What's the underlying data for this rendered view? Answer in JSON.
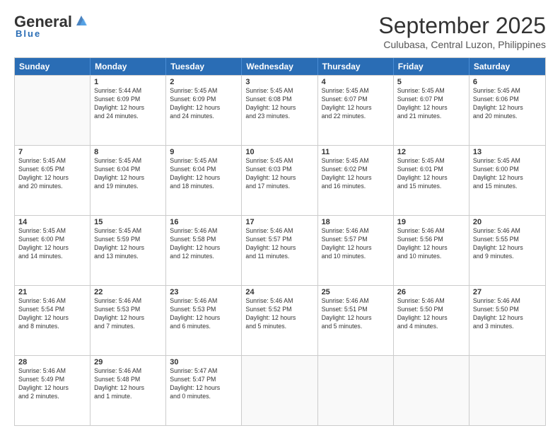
{
  "header": {
    "logo_general": "General",
    "logo_blue": "Blue",
    "month_title": "September 2025",
    "subtitle": "Culubasa, Central Luzon, Philippines"
  },
  "weekdays": [
    "Sunday",
    "Monday",
    "Tuesday",
    "Wednesday",
    "Thursday",
    "Friday",
    "Saturday"
  ],
  "weeks": [
    [
      {
        "day": "",
        "info": ""
      },
      {
        "day": "1",
        "info": "Sunrise: 5:44 AM\nSunset: 6:09 PM\nDaylight: 12 hours\nand 24 minutes."
      },
      {
        "day": "2",
        "info": "Sunrise: 5:45 AM\nSunset: 6:09 PM\nDaylight: 12 hours\nand 24 minutes."
      },
      {
        "day": "3",
        "info": "Sunrise: 5:45 AM\nSunset: 6:08 PM\nDaylight: 12 hours\nand 23 minutes."
      },
      {
        "day": "4",
        "info": "Sunrise: 5:45 AM\nSunset: 6:07 PM\nDaylight: 12 hours\nand 22 minutes."
      },
      {
        "day": "5",
        "info": "Sunrise: 5:45 AM\nSunset: 6:07 PM\nDaylight: 12 hours\nand 21 minutes."
      },
      {
        "day": "6",
        "info": "Sunrise: 5:45 AM\nSunset: 6:06 PM\nDaylight: 12 hours\nand 20 minutes."
      }
    ],
    [
      {
        "day": "7",
        "info": "Sunrise: 5:45 AM\nSunset: 6:05 PM\nDaylight: 12 hours\nand 20 minutes."
      },
      {
        "day": "8",
        "info": "Sunrise: 5:45 AM\nSunset: 6:04 PM\nDaylight: 12 hours\nand 19 minutes."
      },
      {
        "day": "9",
        "info": "Sunrise: 5:45 AM\nSunset: 6:04 PM\nDaylight: 12 hours\nand 18 minutes."
      },
      {
        "day": "10",
        "info": "Sunrise: 5:45 AM\nSunset: 6:03 PM\nDaylight: 12 hours\nand 17 minutes."
      },
      {
        "day": "11",
        "info": "Sunrise: 5:45 AM\nSunset: 6:02 PM\nDaylight: 12 hours\nand 16 minutes."
      },
      {
        "day": "12",
        "info": "Sunrise: 5:45 AM\nSunset: 6:01 PM\nDaylight: 12 hours\nand 15 minutes."
      },
      {
        "day": "13",
        "info": "Sunrise: 5:45 AM\nSunset: 6:00 PM\nDaylight: 12 hours\nand 15 minutes."
      }
    ],
    [
      {
        "day": "14",
        "info": "Sunrise: 5:45 AM\nSunset: 6:00 PM\nDaylight: 12 hours\nand 14 minutes."
      },
      {
        "day": "15",
        "info": "Sunrise: 5:45 AM\nSunset: 5:59 PM\nDaylight: 12 hours\nand 13 minutes."
      },
      {
        "day": "16",
        "info": "Sunrise: 5:46 AM\nSunset: 5:58 PM\nDaylight: 12 hours\nand 12 minutes."
      },
      {
        "day": "17",
        "info": "Sunrise: 5:46 AM\nSunset: 5:57 PM\nDaylight: 12 hours\nand 11 minutes."
      },
      {
        "day": "18",
        "info": "Sunrise: 5:46 AM\nSunset: 5:57 PM\nDaylight: 12 hours\nand 10 minutes."
      },
      {
        "day": "19",
        "info": "Sunrise: 5:46 AM\nSunset: 5:56 PM\nDaylight: 12 hours\nand 10 minutes."
      },
      {
        "day": "20",
        "info": "Sunrise: 5:46 AM\nSunset: 5:55 PM\nDaylight: 12 hours\nand 9 minutes."
      }
    ],
    [
      {
        "day": "21",
        "info": "Sunrise: 5:46 AM\nSunset: 5:54 PM\nDaylight: 12 hours\nand 8 minutes."
      },
      {
        "day": "22",
        "info": "Sunrise: 5:46 AM\nSunset: 5:53 PM\nDaylight: 12 hours\nand 7 minutes."
      },
      {
        "day": "23",
        "info": "Sunrise: 5:46 AM\nSunset: 5:53 PM\nDaylight: 12 hours\nand 6 minutes."
      },
      {
        "day": "24",
        "info": "Sunrise: 5:46 AM\nSunset: 5:52 PM\nDaylight: 12 hours\nand 5 minutes."
      },
      {
        "day": "25",
        "info": "Sunrise: 5:46 AM\nSunset: 5:51 PM\nDaylight: 12 hours\nand 5 minutes."
      },
      {
        "day": "26",
        "info": "Sunrise: 5:46 AM\nSunset: 5:50 PM\nDaylight: 12 hours\nand 4 minutes."
      },
      {
        "day": "27",
        "info": "Sunrise: 5:46 AM\nSunset: 5:50 PM\nDaylight: 12 hours\nand 3 minutes."
      }
    ],
    [
      {
        "day": "28",
        "info": "Sunrise: 5:46 AM\nSunset: 5:49 PM\nDaylight: 12 hours\nand 2 minutes."
      },
      {
        "day": "29",
        "info": "Sunrise: 5:46 AM\nSunset: 5:48 PM\nDaylight: 12 hours\nand 1 minute."
      },
      {
        "day": "30",
        "info": "Sunrise: 5:47 AM\nSunset: 5:47 PM\nDaylight: 12 hours\nand 0 minutes."
      },
      {
        "day": "",
        "info": ""
      },
      {
        "day": "",
        "info": ""
      },
      {
        "day": "",
        "info": ""
      },
      {
        "day": "",
        "info": ""
      }
    ]
  ]
}
